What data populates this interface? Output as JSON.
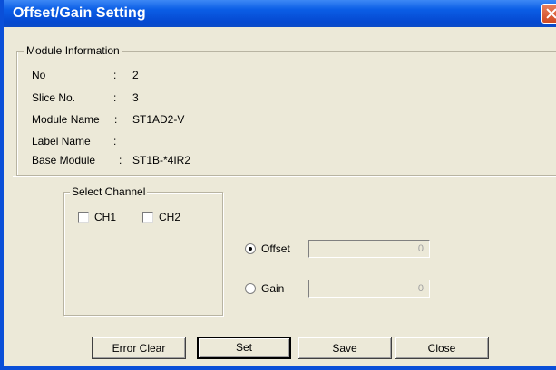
{
  "window": {
    "title": "Offset/Gain Setting"
  },
  "module_info": {
    "legend": "Module Information",
    "rows": [
      {
        "label": "No",
        "sep": ":",
        "value": "2"
      },
      {
        "label": "Slice No.",
        "sep": ":",
        "value": "3"
      },
      {
        "label": "Module Name",
        "sep": ":",
        "value": "ST1AD2-V"
      },
      {
        "label": "Label Name",
        "sep": ":",
        "value": ""
      },
      {
        "label": "Base Module",
        "sep": ":",
        "value": "ST1B-*4IR2"
      }
    ]
  },
  "select_channel": {
    "legend": "Select Channel",
    "ch1": {
      "label": "CH1",
      "checked": false
    },
    "ch2": {
      "label": "CH2",
      "checked": false
    }
  },
  "mode": {
    "offset": {
      "label": "Offset",
      "selected": true,
      "value": "0"
    },
    "gain": {
      "label": "Gain",
      "selected": false,
      "value": "0"
    }
  },
  "buttons": {
    "error_clear": "Error Clear",
    "set": "Set",
    "save": "Save",
    "close": "Close"
  }
}
